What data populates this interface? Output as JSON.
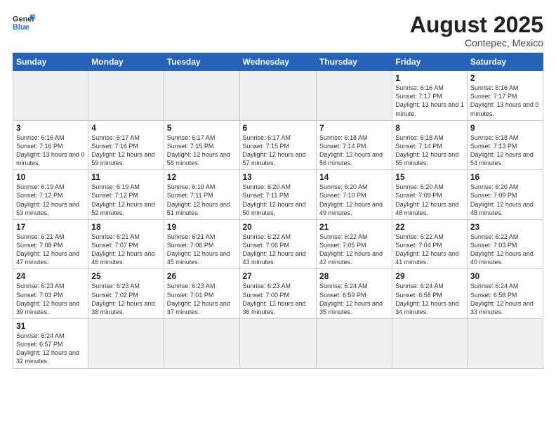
{
  "logo": {
    "text_general": "General",
    "text_blue": "Blue"
  },
  "title": "August 2025",
  "subtitle": "Contepec, Mexico",
  "days_of_week": [
    "Sunday",
    "Monday",
    "Tuesday",
    "Wednesday",
    "Thursday",
    "Friday",
    "Saturday"
  ],
  "weeks": [
    [
      {
        "num": "",
        "info": "",
        "empty": true
      },
      {
        "num": "",
        "info": "",
        "empty": true
      },
      {
        "num": "",
        "info": "",
        "empty": true
      },
      {
        "num": "",
        "info": "",
        "empty": true
      },
      {
        "num": "",
        "info": "",
        "empty": true
      },
      {
        "num": "1",
        "info": "Sunrise: 6:16 AM\nSunset: 7:17 PM\nDaylight: 13 hours\nand 1 minute."
      },
      {
        "num": "2",
        "info": "Sunrise: 6:16 AM\nSunset: 7:17 PM\nDaylight: 13 hours\nand 0 minutes."
      }
    ],
    [
      {
        "num": "3",
        "info": "Sunrise: 6:16 AM\nSunset: 7:16 PM\nDaylight: 13 hours\nand 0 minutes."
      },
      {
        "num": "4",
        "info": "Sunrise: 6:17 AM\nSunset: 7:16 PM\nDaylight: 12 hours\nand 59 minutes."
      },
      {
        "num": "5",
        "info": "Sunrise: 6:17 AM\nSunset: 7:15 PM\nDaylight: 12 hours\nand 58 minutes."
      },
      {
        "num": "6",
        "info": "Sunrise: 6:17 AM\nSunset: 7:15 PM\nDaylight: 12 hours\nand 57 minutes."
      },
      {
        "num": "7",
        "info": "Sunrise: 6:18 AM\nSunset: 7:14 PM\nDaylight: 12 hours\nand 56 minutes."
      },
      {
        "num": "8",
        "info": "Sunrise: 6:18 AM\nSunset: 7:14 PM\nDaylight: 12 hours\nand 55 minutes."
      },
      {
        "num": "9",
        "info": "Sunrise: 6:18 AM\nSunset: 7:13 PM\nDaylight: 12 hours\nand 54 minutes."
      }
    ],
    [
      {
        "num": "10",
        "info": "Sunrise: 6:19 AM\nSunset: 7:12 PM\nDaylight: 12 hours\nand 53 minutes."
      },
      {
        "num": "11",
        "info": "Sunrise: 6:19 AM\nSunset: 7:12 PM\nDaylight: 12 hours\nand 52 minutes."
      },
      {
        "num": "12",
        "info": "Sunrise: 6:19 AM\nSunset: 7:11 PM\nDaylight: 12 hours\nand 51 minutes."
      },
      {
        "num": "13",
        "info": "Sunrise: 6:20 AM\nSunset: 7:11 PM\nDaylight: 12 hours\nand 50 minutes."
      },
      {
        "num": "14",
        "info": "Sunrise: 6:20 AM\nSunset: 7:10 PM\nDaylight: 12 hours\nand 49 minutes."
      },
      {
        "num": "15",
        "info": "Sunrise: 6:20 AM\nSunset: 7:09 PM\nDaylight: 12 hours\nand 48 minutes."
      },
      {
        "num": "16",
        "info": "Sunrise: 6:20 AM\nSunset: 7:09 PM\nDaylight: 12 hours\nand 48 minutes."
      }
    ],
    [
      {
        "num": "17",
        "info": "Sunrise: 6:21 AM\nSunset: 7:08 PM\nDaylight: 12 hours\nand 47 minutes."
      },
      {
        "num": "18",
        "info": "Sunrise: 6:21 AM\nSunset: 7:07 PM\nDaylight: 12 hours\nand 46 minutes."
      },
      {
        "num": "19",
        "info": "Sunrise: 6:21 AM\nSunset: 7:06 PM\nDaylight: 12 hours\nand 45 minutes."
      },
      {
        "num": "20",
        "info": "Sunrise: 6:22 AM\nSunset: 7:06 PM\nDaylight: 12 hours\nand 43 minutes."
      },
      {
        "num": "21",
        "info": "Sunrise: 6:22 AM\nSunset: 7:05 PM\nDaylight: 12 hours\nand 42 minutes."
      },
      {
        "num": "22",
        "info": "Sunrise: 6:22 AM\nSunset: 7:04 PM\nDaylight: 12 hours\nand 41 minutes."
      },
      {
        "num": "23",
        "info": "Sunrise: 6:22 AM\nSunset: 7:03 PM\nDaylight: 12 hours\nand 40 minutes."
      }
    ],
    [
      {
        "num": "24",
        "info": "Sunrise: 6:23 AM\nSunset: 7:03 PM\nDaylight: 12 hours\nand 39 minutes."
      },
      {
        "num": "25",
        "info": "Sunrise: 6:23 AM\nSunset: 7:02 PM\nDaylight: 12 hours\nand 38 minutes."
      },
      {
        "num": "26",
        "info": "Sunrise: 6:23 AM\nSunset: 7:01 PM\nDaylight: 12 hours\nand 37 minutes."
      },
      {
        "num": "27",
        "info": "Sunrise: 6:23 AM\nSunset: 7:00 PM\nDaylight: 12 hours\nand 36 minutes."
      },
      {
        "num": "28",
        "info": "Sunrise: 6:24 AM\nSunset: 6:59 PM\nDaylight: 12 hours\nand 35 minutes."
      },
      {
        "num": "29",
        "info": "Sunrise: 6:24 AM\nSunset: 6:58 PM\nDaylight: 12 hours\nand 34 minutes."
      },
      {
        "num": "30",
        "info": "Sunrise: 6:24 AM\nSunset: 6:58 PM\nDaylight: 12 hours\nand 33 minutes."
      }
    ],
    [
      {
        "num": "31",
        "info": "Sunrise: 6:24 AM\nSunset: 6:57 PM\nDaylight: 12 hours\nand 32 minutes."
      },
      {
        "num": "",
        "info": "",
        "empty": true
      },
      {
        "num": "",
        "info": "",
        "empty": true
      },
      {
        "num": "",
        "info": "",
        "empty": true
      },
      {
        "num": "",
        "info": "",
        "empty": true
      },
      {
        "num": "",
        "info": "",
        "empty": true
      },
      {
        "num": "",
        "info": "",
        "empty": true
      }
    ]
  ]
}
